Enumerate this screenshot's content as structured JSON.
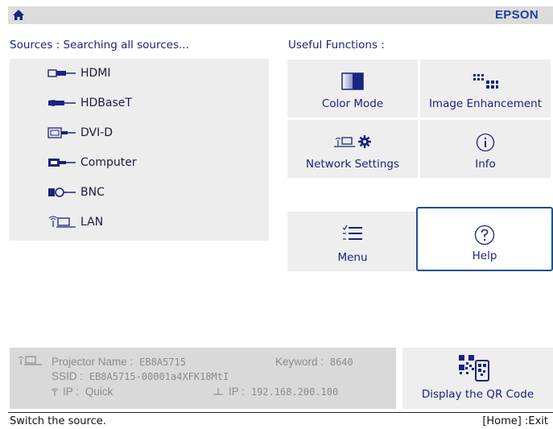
{
  "topbar": {
    "brand": "EPSON",
    "home_icon": "home-icon"
  },
  "sources": {
    "title": "Sources : Searching all sources...",
    "items": [
      {
        "label": "HDMI",
        "icon": "hdmi-connector-icon"
      },
      {
        "label": "HDBaseT",
        "icon": "hdbaset-connector-icon"
      },
      {
        "label": "DVI-D",
        "icon": "dvi-connector-icon"
      },
      {
        "label": "Computer",
        "icon": "vga-connector-icon"
      },
      {
        "label": "BNC",
        "icon": "bnc-connector-icon"
      },
      {
        "label": "LAN",
        "icon": "lan-icon"
      }
    ]
  },
  "useful_functions": {
    "title": "Useful Functions :",
    "items": [
      {
        "label": "Color Mode",
        "icon": "color-mode-icon"
      },
      {
        "label": "Image Enhancement",
        "icon": "image-enhancement-icon"
      },
      {
        "label": "Network Settings",
        "icon": "network-settings-icon"
      },
      {
        "label": "Info",
        "icon": "info-icon"
      },
      {
        "label": "Menu",
        "icon": "menu-icon"
      },
      {
        "label": "Help",
        "icon": "help-icon",
        "selected": true
      }
    ]
  },
  "network_info": {
    "projector_name_label": "Projector Name :",
    "projector_name": "EB8A5715",
    "keyword_label": "Keyword :",
    "keyword": "8640",
    "ssid_label": "SSID :",
    "ssid": "EB8A5715-00001a4XFK18MtI",
    "wireless_ip_label": "IP :",
    "wireless_ip": "Quick",
    "wired_ip_label": "IP :",
    "wired_ip": "192.168.200.100"
  },
  "qr": {
    "label": "Display the QR Code",
    "icon": "qr-code-icon"
  },
  "status": {
    "left": "Switch the source.",
    "right": "[Home] :Exit"
  },
  "colors": {
    "accent": "#1a237e",
    "brand": "#1f3fa0",
    "selected_border": "#1f4f8f"
  }
}
